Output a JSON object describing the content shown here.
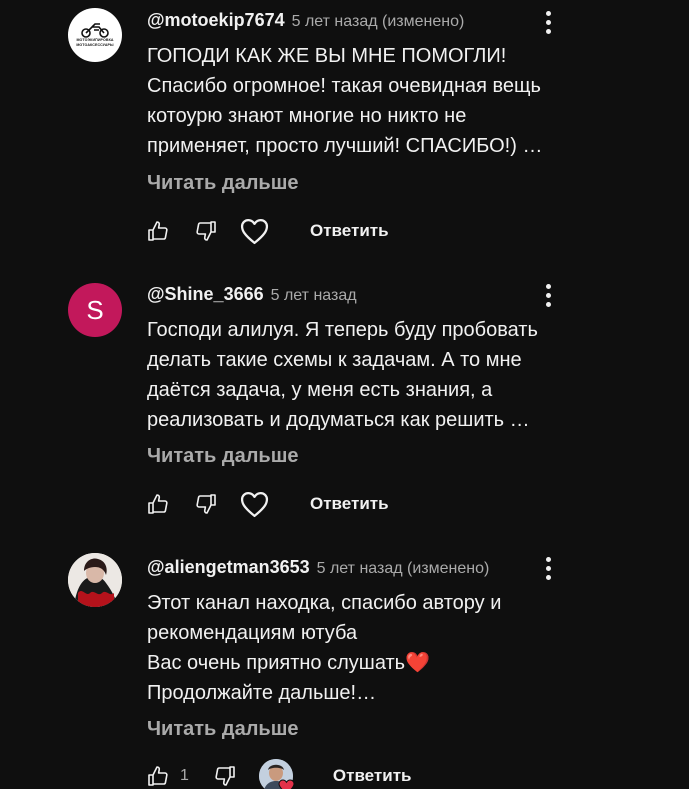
{
  "comments": [
    {
      "author": "@motoekip7674",
      "time": "5 лет назад (изменено)",
      "avatar": {
        "type": "logo",
        "lines": [
          "МОТОЭКИПИРОВКА",
          "МОТОАКСЕССУАРЫ"
        ]
      },
      "lines": [
        "ГОПОДИ КАК ЖЕ ВЫ МНЕ ПОМОГЛИ!",
        "Спасибо огромное! такая очевидная вещь",
        "котоурю знают многие но никто не",
        "применяет, просто лучший! СПАСИБО!) …"
      ],
      "read_more": "Читать дальше",
      "reply": "Ответить",
      "heart_style": "outline"
    },
    {
      "author": "@Shine_3666",
      "time": "5 лет назад",
      "avatar": {
        "type": "letter",
        "letter": "S",
        "color": "#c2185b"
      },
      "lines": [
        "Господи алилуя. Я теперь буду пробовать",
        "делать такие схемы к задачам. А то мне",
        "даётся задача, у меня есть знания, а",
        "реализовать и додуматься как решить …"
      ],
      "read_more": "Читать дальше",
      "reply": "Ответить",
      "heart_style": "outline"
    },
    {
      "author": "@aliengetman3653",
      "time": "5 лет назад (изменено)",
      "avatar": {
        "type": "photo"
      },
      "lines": [
        "Этот канал находка, спасибо автору и",
        "рекомендациям ютуба",
        "Вас очень приятно слушать",
        "Продолжайте дальше!…"
      ],
      "heart_emoji": "❤️",
      "read_more": "Читать дальше",
      "likes": "1",
      "reply": "Ответить",
      "heart_style": "creator"
    }
  ],
  "icons": {
    "like": "thumb-up-icon",
    "dislike": "thumb-down-icon",
    "heart": "heart-icon",
    "menu": "more-vert-icon"
  },
  "colors": {
    "background": "#0f0f0f",
    "text_primary": "#f1f1f1",
    "text_secondary": "#aaaaaa",
    "heart_red": "#e3324a"
  }
}
